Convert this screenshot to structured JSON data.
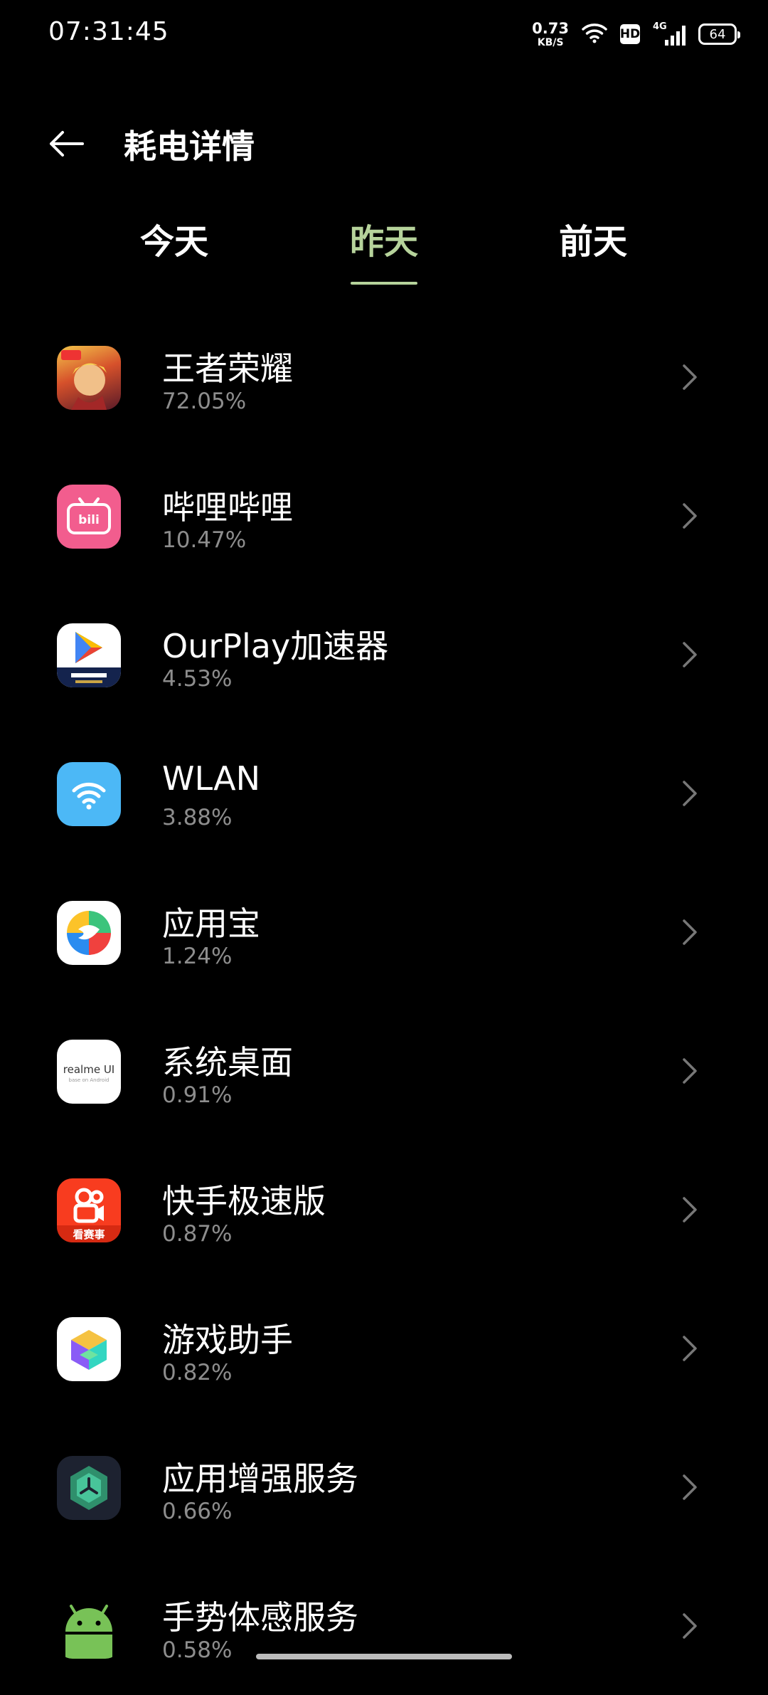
{
  "status_bar": {
    "time": "07:31:45",
    "net_speed_value": "0.73",
    "net_speed_unit": "KB/S",
    "hd_label": "HD",
    "network_type": "4G",
    "battery": "64"
  },
  "header": {
    "title": "耗电详情",
    "back_icon": "arrow-left-icon"
  },
  "tabs": [
    {
      "label": "今天",
      "active": false
    },
    {
      "label": "昨天",
      "active": true
    },
    {
      "label": "前天",
      "active": false
    }
  ],
  "accent_color": "#b6d39b",
  "apps": [
    {
      "name": "王者荣耀",
      "percent": "72.05%",
      "icon": "game-hero-icon"
    },
    {
      "name": "哔哩哔哩",
      "percent": "10.47%",
      "icon": "bilibili-icon"
    },
    {
      "name": "OurPlay加速器",
      "percent": "4.53%",
      "icon": "ourplay-icon"
    },
    {
      "name": "WLAN",
      "percent": "3.88%",
      "icon": "wifi-icon"
    },
    {
      "name": "应用宝",
      "percent": "1.24%",
      "icon": "app-store-icon"
    },
    {
      "name": "系统桌面",
      "percent": "0.91%",
      "icon": "realme-ui-icon",
      "icon_text": "realme UI",
      "icon_subtext": "base on Android"
    },
    {
      "name": "快手极速版",
      "percent": "0.87%",
      "icon": "kuaishou-icon",
      "icon_text": "看赛事"
    },
    {
      "name": "游戏助手",
      "percent": "0.82%",
      "icon": "game-assistant-icon"
    },
    {
      "name": "应用增强服务",
      "percent": "0.66%",
      "icon": "app-enhance-icon"
    },
    {
      "name": "手势体感服务",
      "percent": "0.58%",
      "icon": "android-icon"
    }
  ]
}
